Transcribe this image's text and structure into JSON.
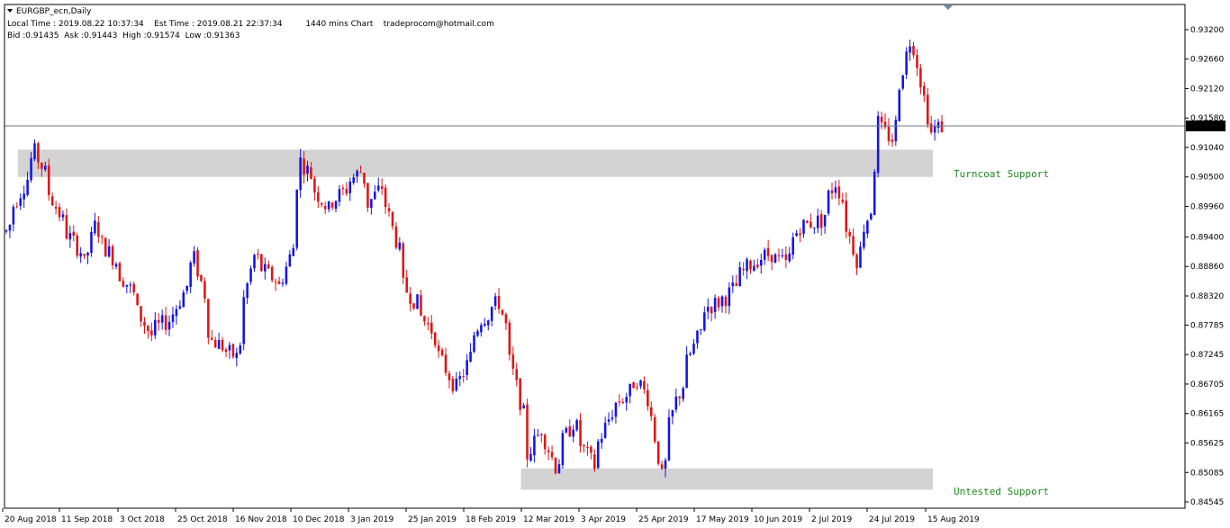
{
  "header": {
    "symbol": "EURGBP_ecn,Daily",
    "line2": "Local Time : 2019.08.22 10:37:34    Est Time : 2019.08.21 22:37:34         1440 mins Chart    tradeprocom@hotmail.com",
    "line3": "Bid :0.91435  Ask :0.91443  High :0.91574  Low :0.91363"
  },
  "colors": {
    "bull": "#1414e6",
    "bear": "#e01414",
    "zone": "#d3d3d3",
    "zone_label": "#1f8a1f",
    "grid": "#000000",
    "price_tag_bg": "#000000",
    "price_tag_fg": "#ffffff"
  },
  "chart_data": {
    "type": "candlestick",
    "ylim": [
      0.8443,
      0.9366
    ],
    "y_ticks": [
      "0.93200",
      "0.92660",
      "0.92120",
      "0.91580",
      "0.91040",
      "0.90500",
      "0.89960",
      "0.89400",
      "0.88860",
      "0.88320",
      "0.87785",
      "0.87245",
      "0.86705",
      "0.86165",
      "0.85625",
      "0.85085",
      "0.84545"
    ],
    "x_ticks": [
      "20 Aug 2018",
      "11 Sep 2018",
      "3 Oct 2018",
      "25 Oct 2018",
      "16 Nov 2018",
      "10 Dec 2018",
      "3 Jan 2019",
      "25 Jan 2019",
      "18 Feb 2019",
      "12 Mar 2019",
      "3 Apr 2019",
      "25 Apr 2019",
      "17 May 2019",
      "10 Jun 2019",
      "2 Jul 2019",
      "24 Jul 2019",
      "15 Aug 2019"
    ],
    "current_price": "0.91435",
    "zones": [
      {
        "label": "Turncoat Support",
        "from_date": "2018-08-22",
        "to_date": "2019-08-20",
        "low": 0.905,
        "high": 0.91
      },
      {
        "label": "Untested Support",
        "from_date": "2019-03-08",
        "to_date": "2019-08-20",
        "low": 0.8477,
        "high": 0.8516
      }
    ],
    "keypoints": [
      [
        "2018-08-16",
        0.895
      ],
      [
        "2018-08-28",
        0.9095
      ],
      [
        "2018-09-07",
        0.897
      ],
      [
        "2018-09-17",
        0.889
      ],
      [
        "2018-09-20",
        0.896
      ],
      [
        "2018-10-03",
        0.8855
      ],
      [
        "2018-10-12",
        0.876
      ],
      [
        "2018-10-22",
        0.88
      ],
      [
        "2018-10-30",
        0.89
      ],
      [
        "2018-11-06",
        0.875
      ],
      [
        "2018-11-15",
        0.872
      ],
      [
        "2018-11-22",
        0.8905
      ],
      [
        "2018-11-28",
        0.887
      ],
      [
        "2018-12-03",
        0.885
      ],
      [
        "2018-12-07",
        0.892
      ],
      [
        "2018-12-11",
        0.908
      ],
      [
        "2018-12-21",
        0.899
      ],
      [
        "2019-01-03",
        0.906
      ],
      [
        "2019-01-07",
        0.9
      ],
      [
        "2019-01-12",
        0.904
      ],
      [
        "2019-01-21",
        0.885
      ],
      [
        "2019-01-31",
        0.877
      ],
      [
        "2019-02-10",
        0.865
      ],
      [
        "2019-02-20",
        0.879
      ],
      [
        "2019-02-27",
        0.882
      ],
      [
        "2019-03-05",
        0.869
      ],
      [
        "2019-03-11",
        0.854
      ],
      [
        "2019-03-16",
        0.86
      ],
      [
        "2019-03-21",
        0.852
      ],
      [
        "2019-03-28",
        0.86
      ],
      [
        "2019-04-05",
        0.852
      ],
      [
        "2019-04-12",
        0.862
      ],
      [
        "2019-04-18",
        0.865
      ],
      [
        "2019-04-23",
        0.868
      ],
      [
        "2019-04-29",
        0.861
      ],
      [
        "2019-05-02",
        0.85
      ],
      [
        "2019-05-08",
        0.864
      ],
      [
        "2019-05-20",
        0.881
      ],
      [
        "2019-05-28",
        0.883
      ],
      [
        "2019-06-06",
        0.889
      ],
      [
        "2019-06-14",
        0.891
      ],
      [
        "2019-06-20",
        0.889
      ],
      [
        "2019-06-26",
        0.896
      ],
      [
        "2019-07-04",
        0.897
      ],
      [
        "2019-07-10",
        0.904
      ],
      [
        "2019-07-15",
        0.896
      ],
      [
        "2019-07-18",
        0.89
      ],
      [
        "2019-07-24",
        0.899
      ],
      [
        "2019-07-26",
        0.915
      ],
      [
        "2019-08-01",
        0.912
      ],
      [
        "2019-08-08",
        0.93
      ],
      [
        "2019-08-12",
        0.926
      ],
      [
        "2019-08-16",
        0.913
      ],
      [
        "2019-08-21",
        0.9143
      ]
    ]
  },
  "annotations": {
    "turncoat": "Turncoat Support",
    "untested": "Untested Support"
  }
}
